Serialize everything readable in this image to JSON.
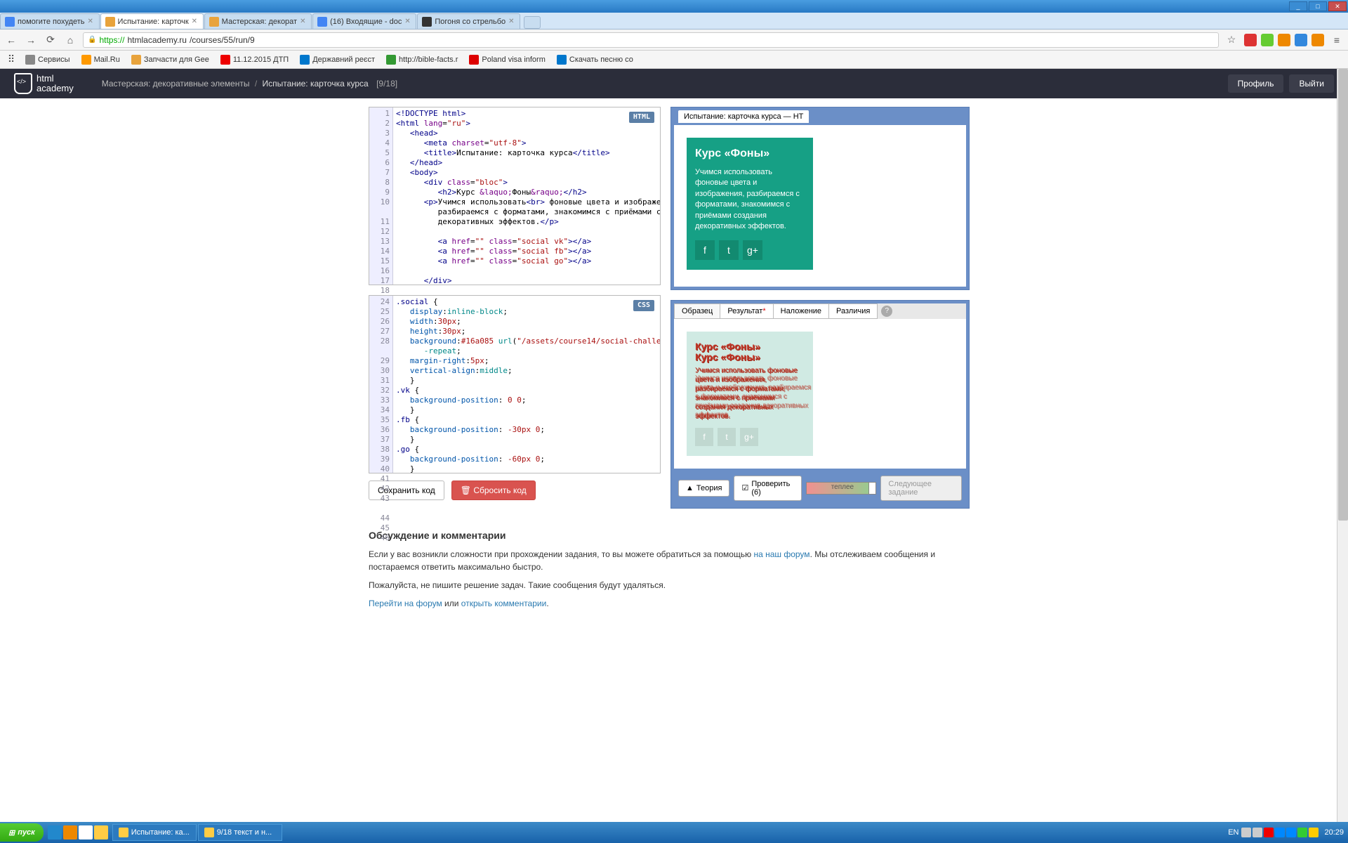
{
  "window": {
    "min": "_",
    "max": "□",
    "close": "✕"
  },
  "tabs": [
    {
      "title": "помогите похудеть",
      "fav": "#4285f4"
    },
    {
      "title": "Испытание: карточк",
      "fav": "#e8a33c",
      "active": true
    },
    {
      "title": "Мастерская: декорат",
      "fav": "#e8a33c"
    },
    {
      "title": "(16) Входящие - doc",
      "fav": "#4285f4"
    },
    {
      "title": "Погоня со стрельбо",
      "fav": "#333"
    }
  ],
  "address": {
    "proto": "https://",
    "host": "htmlacademy.ru",
    "path": "/courses/55/run/9"
  },
  "ext_colors": [
    "#d33",
    "#6c3",
    "#e80",
    "#38d",
    "#e80"
  ],
  "bookmarks": [
    {
      "t": "Сервисы",
      "c": "#888"
    },
    {
      "t": "Mail.Ru",
      "c": "#f90"
    },
    {
      "t": "Запчасти для Gee",
      "c": "#e8a33c"
    },
    {
      "t": "11.12.2015 ДТП",
      "c": "#e00"
    },
    {
      "t": "Державний реєст",
      "c": "#07c"
    },
    {
      "t": "http://bible-facts.r",
      "c": "#393"
    },
    {
      "t": "Poland visa inform",
      "c": "#d00"
    },
    {
      "t": "Скачать песню со",
      "c": "#07c"
    }
  ],
  "header": {
    "logo1": "html",
    "logo2": "academy",
    "crumb1": "Мастерская: декоративные элементы",
    "crumb2": "Испытание: карточка курса",
    "page": "[9/18]",
    "profile": "Профиль",
    "logout": "Выйти"
  },
  "html_editor": {
    "badge": "HTML",
    "lines": [
      "1",
      "2",
      "3",
      "4",
      "5",
      "6",
      "7",
      "8",
      "9",
      "10",
      "",
      "11",
      "12",
      "13",
      "14",
      "15",
      "16",
      "17",
      "18"
    ]
  },
  "css_editor": {
    "badge": "CSS",
    "lines": [
      "24",
      "25",
      "26",
      "27",
      "28",
      "",
      "29",
      "30",
      "31",
      "32",
      "33",
      "34",
      "35",
      "36",
      "37",
      "38",
      "39",
      "40",
      "41",
      "42",
      "43",
      "",
      "44",
      "45",
      "46"
    ]
  },
  "buttons": {
    "save": "Сохранить код",
    "reset": "Сбросить код"
  },
  "preview": {
    "tab": "Испытание: карточка курса — HT",
    "card_title": "Курс «Фоны»",
    "card_text": "Учимся использовать фоновые цвета и изображения, разбираемся с форматами, знакомимся с приёмами создания декоративных эффектов."
  },
  "result": {
    "tabs": [
      "Образец",
      "Результат",
      "Наложение",
      "Различия"
    ],
    "help": "?",
    "dbl1": "Курс «Фоны»",
    "dbl2": "Курс «Фоны»",
    "txt": "Учимся использовать фоновые цвета и изображения, разбираемся с форматами, знакомимся с приёмами создания декоративных эффектов.",
    "theory": "Теория",
    "check": "Проверить (6)",
    "prog": "теплее",
    "next": "Следующее задание"
  },
  "discuss": {
    "h": "Обсуждение и комментарии",
    "p1a": "Если у вас возникли сложности при прохождении задания, то вы можете обратиться за помощью ",
    "p1l": "на наш форум",
    "p1b": ". Мы отслеживаем сообщения и постараемся ответить максимально быстро.",
    "p2": "Пожалуйста, не пишите решение задач. Такие сообщения будут удаляться.",
    "p3a": "Перейти на форум",
    "p3m": " или ",
    "p3b": "открыть комментарии",
    "p3e": "."
  },
  "taskbar": {
    "start": "пуск",
    "ql_colors": [
      "#28c",
      "#e80",
      "#fff",
      "#fc4"
    ],
    "tasks": [
      {
        "t": "Испытание: ка...",
        "c": "#fc4"
      },
      {
        "t": "9/18 текст и н...",
        "c": "#fc4"
      }
    ],
    "lang": "EN",
    "clock": "20:29",
    "tray_colors": [
      "#ccc",
      "#ccc",
      "#e00",
      "#08f",
      "#08f",
      "#3c3",
      "#fc0"
    ]
  }
}
